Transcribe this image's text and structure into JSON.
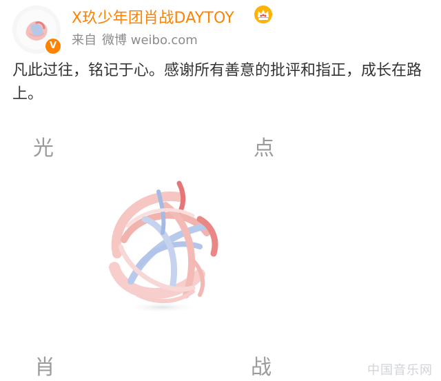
{
  "header": {
    "user_name": "X玖少年团肖战DAYTOY",
    "source_prefix": "来自",
    "source_app": "微博 weibo.com",
    "verified_badge": "V",
    "crown_icon": "crown-icon"
  },
  "post": {
    "text": "凡此过往，铭记于心。感谢所有善意的批评和指正，成长在路上。"
  },
  "image": {
    "corner_tl": "光",
    "corner_tr": "点",
    "corner_bl": "肖",
    "corner_br": "战",
    "watermark": "中国音乐网"
  },
  "colors": {
    "accent": "#ff8200",
    "text": "#333333",
    "meta": "#8b8b8b"
  }
}
